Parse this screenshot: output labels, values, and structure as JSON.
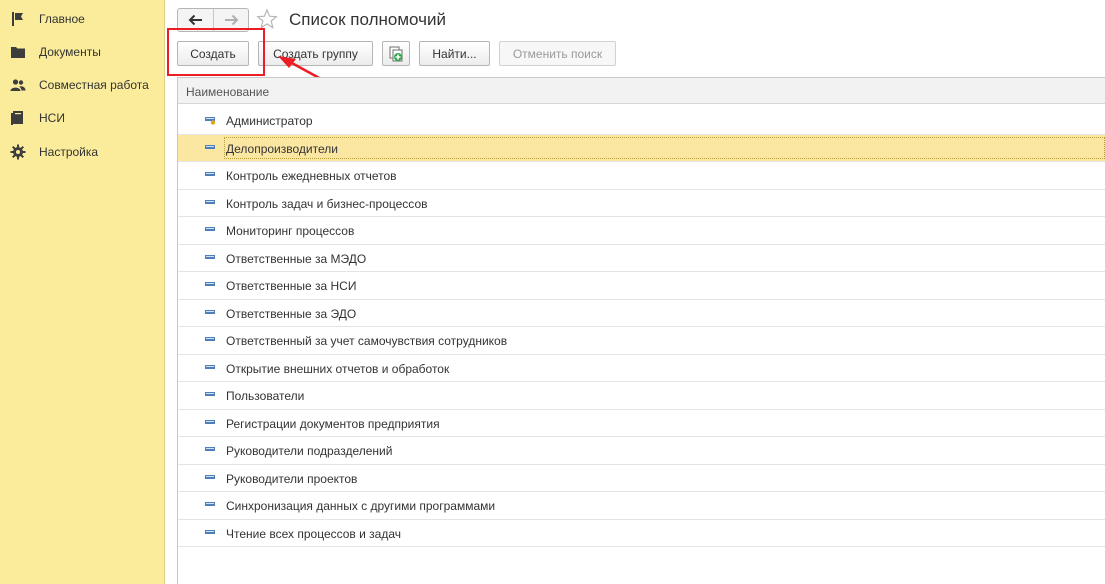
{
  "sidebar": {
    "items": [
      {
        "label": "Главное",
        "icon": "flag-icon"
      },
      {
        "label": "Документы",
        "icon": "folder-icon"
      },
      {
        "label": "Совместная работа",
        "icon": "users-icon"
      },
      {
        "label": "НСИ",
        "icon": "book-icon"
      },
      {
        "label": "Настройка",
        "icon": "gear-icon"
      }
    ]
  },
  "header": {
    "title": "Список полномочий",
    "back_icon": "arrow-left-icon",
    "forward_icon": "arrow-right-icon",
    "favorite_icon": "star-icon"
  },
  "toolbar": {
    "create_label": "Создать",
    "create_group_label": "Создать группу",
    "copy_icon": "copy-add-icon",
    "find_label": "Найти...",
    "cancel_search_label": "Отменить поиск"
  },
  "list": {
    "column_header": "Наименование",
    "selected_index": 1,
    "rows": [
      {
        "label": "Администратор",
        "icon": "item-key-icon"
      },
      {
        "label": "Делопроизводители",
        "icon": "item-icon"
      },
      {
        "label": "Контроль ежедневных отчетов",
        "icon": "item-icon"
      },
      {
        "label": "Контроль задач и бизнес-процессов",
        "icon": "item-icon"
      },
      {
        "label": "Мониторинг процессов",
        "icon": "item-icon"
      },
      {
        "label": "Ответственные за МЭДО",
        "icon": "item-icon"
      },
      {
        "label": "Ответственные за НСИ",
        "icon": "item-icon"
      },
      {
        "label": "Ответственные за ЭДО",
        "icon": "item-icon"
      },
      {
        "label": "Ответственный за учет самочувствия сотрудников",
        "icon": "item-icon"
      },
      {
        "label": "Открытие внешних отчетов и обработок",
        "icon": "item-icon"
      },
      {
        "label": "Пользователи",
        "icon": "item-icon"
      },
      {
        "label": "Регистрации документов предприятия",
        "icon": "item-icon"
      },
      {
        "label": "Руководители подразделений",
        "icon": "item-icon"
      },
      {
        "label": "Руководители проектов",
        "icon": "item-icon"
      },
      {
        "label": "Синхронизация данных с другими программами",
        "icon": "item-icon"
      },
      {
        "label": "Чтение всех процессов и задач",
        "icon": "item-icon"
      }
    ]
  },
  "colors": {
    "sidebar_bg": "#fbec9c",
    "selected_row": "#fbe6a2",
    "annotation_red": "#ee1c25"
  }
}
